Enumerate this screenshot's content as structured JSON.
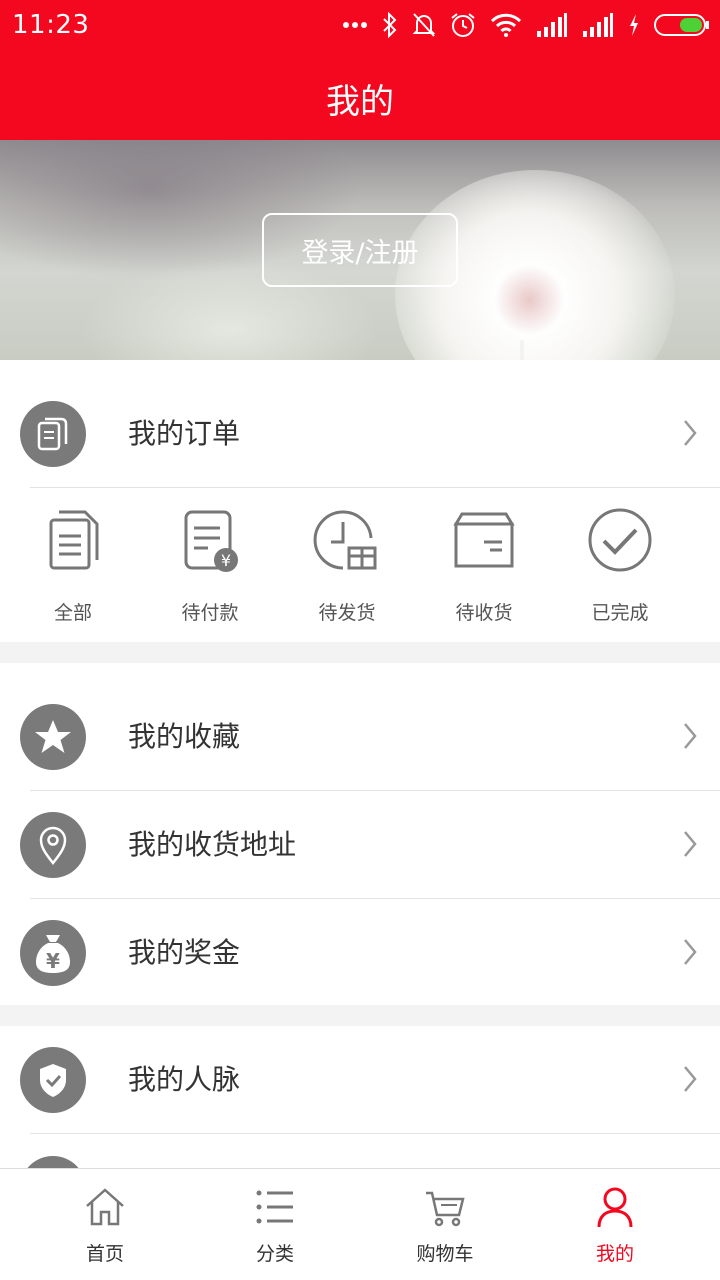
{
  "status_bar": {
    "time": "11:23"
  },
  "header": {
    "title": "我的"
  },
  "banner": {
    "login_label": "登录/注册"
  },
  "my_orders": {
    "label": "我的订单",
    "statuses": [
      {
        "label": "全部",
        "icon": "documents-icon"
      },
      {
        "label": "待付款",
        "icon": "bill-yen-icon"
      },
      {
        "label": "待发货",
        "icon": "clock-gift-icon"
      },
      {
        "label": "待收货",
        "icon": "box-icon"
      },
      {
        "label": "已完成",
        "icon": "check-circle-icon"
      }
    ]
  },
  "menu": [
    {
      "label": "我的收藏",
      "icon": "star-icon"
    },
    {
      "label": "我的收货地址",
      "icon": "location-pin-icon"
    },
    {
      "label": "我的奖金",
      "icon": "money-bag-icon"
    },
    {
      "label": "我的人脉",
      "icon": "shield-check-icon"
    }
  ],
  "bottom_nav": [
    {
      "label": "首页",
      "icon": "home-icon"
    },
    {
      "label": "分类",
      "icon": "list-icon"
    },
    {
      "label": "购物车",
      "icon": "cart-icon"
    },
    {
      "label": "我的",
      "icon": "user-icon",
      "active": true
    }
  ],
  "colors": {
    "brand": "#f4081f",
    "icon_gray": "#7a7a7a",
    "background": "#f3f3f3"
  }
}
